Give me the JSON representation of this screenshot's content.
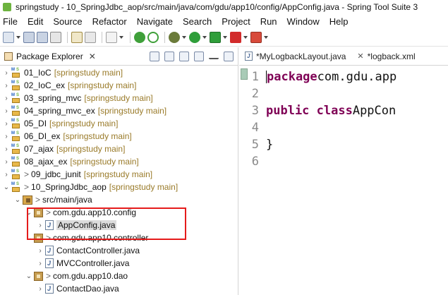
{
  "window": {
    "title": "springstudy - 10_SpringJdbc_aop/src/main/java/com/gdu/app10/config/AppConfig.java - Spring Tool Suite 3"
  },
  "menu": [
    "File",
    "Edit",
    "Source",
    "Refactor",
    "Navigate",
    "Search",
    "Project",
    "Run",
    "Window",
    "Help"
  ],
  "toolbar_icons": [
    "new-icon",
    "save-icon",
    "save-all-icon",
    "print-icon",
    "toggle-mark-icon",
    "spring-boot-dashboard-icon",
    "debug-icon",
    "run-icon",
    "run-external-icon",
    "stop-icon",
    "external-tools-icon"
  ],
  "package_explorer": {
    "tab_label": "Package Explorer",
    "close_glyph": "✕",
    "projects": [
      {
        "name": "01_IoC",
        "tag": "[springstudy main]",
        "expanded": false
      },
      {
        "name": "02_IoC_ex",
        "tag": "[springstudy main]",
        "expanded": false
      },
      {
        "name": "03_spring_mvc",
        "tag": "[springstudy main]",
        "expanded": false
      },
      {
        "name": "04_spring_mvc_ex",
        "tag": "[springstudy main]",
        "expanded": false
      },
      {
        "name": "05_DI",
        "tag": "[springstudy main]",
        "expanded": false
      },
      {
        "name": "06_DI_ex",
        "tag": "[springstudy main]",
        "expanded": false
      },
      {
        "name": "07_ajax",
        "tag": "[springstudy main]",
        "expanded": false
      },
      {
        "name": "08_ajax_ex",
        "tag": "[springstudy main]",
        "expanded": false
      },
      {
        "name": "09_jdbc_junit",
        "tag": "[springstudy main]",
        "prefix": ">",
        "expanded": false
      },
      {
        "name": "10_SpringJdbc_aop",
        "tag": "[springstudy main]",
        "prefix": ">",
        "expanded": true
      }
    ],
    "src_folder": {
      "prefix": ">",
      "name": "src/main/java"
    },
    "pkg_config": {
      "prefix": ">",
      "name": "com.gdu.app10.config"
    },
    "file_appconfig": "AppConfig.java",
    "pkg_controller": {
      "prefix": ">",
      "name": "com.gdu.app10.controller"
    },
    "file_contactcontroller": "ContactController.java",
    "file_mvccontroller": "MVCController.java",
    "pkg_dao": {
      "prefix": ">",
      "name": "com.gdu.app10.dao"
    },
    "file_contactdao": "ContactDao.java"
  },
  "editor": {
    "tabs": [
      {
        "label": "*MyLogbackLayout.java",
        "icon": "java-file-icon"
      },
      {
        "label": "*logback.xml",
        "icon": "xml-file-icon"
      }
    ],
    "lines": [
      {
        "n": "1",
        "kw": "package",
        "rest": " com.gdu.app"
      },
      {
        "n": "2",
        "kw": "",
        "rest": ""
      },
      {
        "n": "3",
        "kw": "public class",
        "rest": " AppCon"
      },
      {
        "n": "4",
        "kw": "",
        "rest": ""
      },
      {
        "n": "5",
        "kw": "",
        "rest": "}"
      },
      {
        "n": "6",
        "kw": "",
        "rest": ""
      }
    ]
  },
  "colors": {
    "highlight_box": "#e51b1b",
    "keyword": "#7f0055",
    "project_tag": "#9a7b2a"
  }
}
